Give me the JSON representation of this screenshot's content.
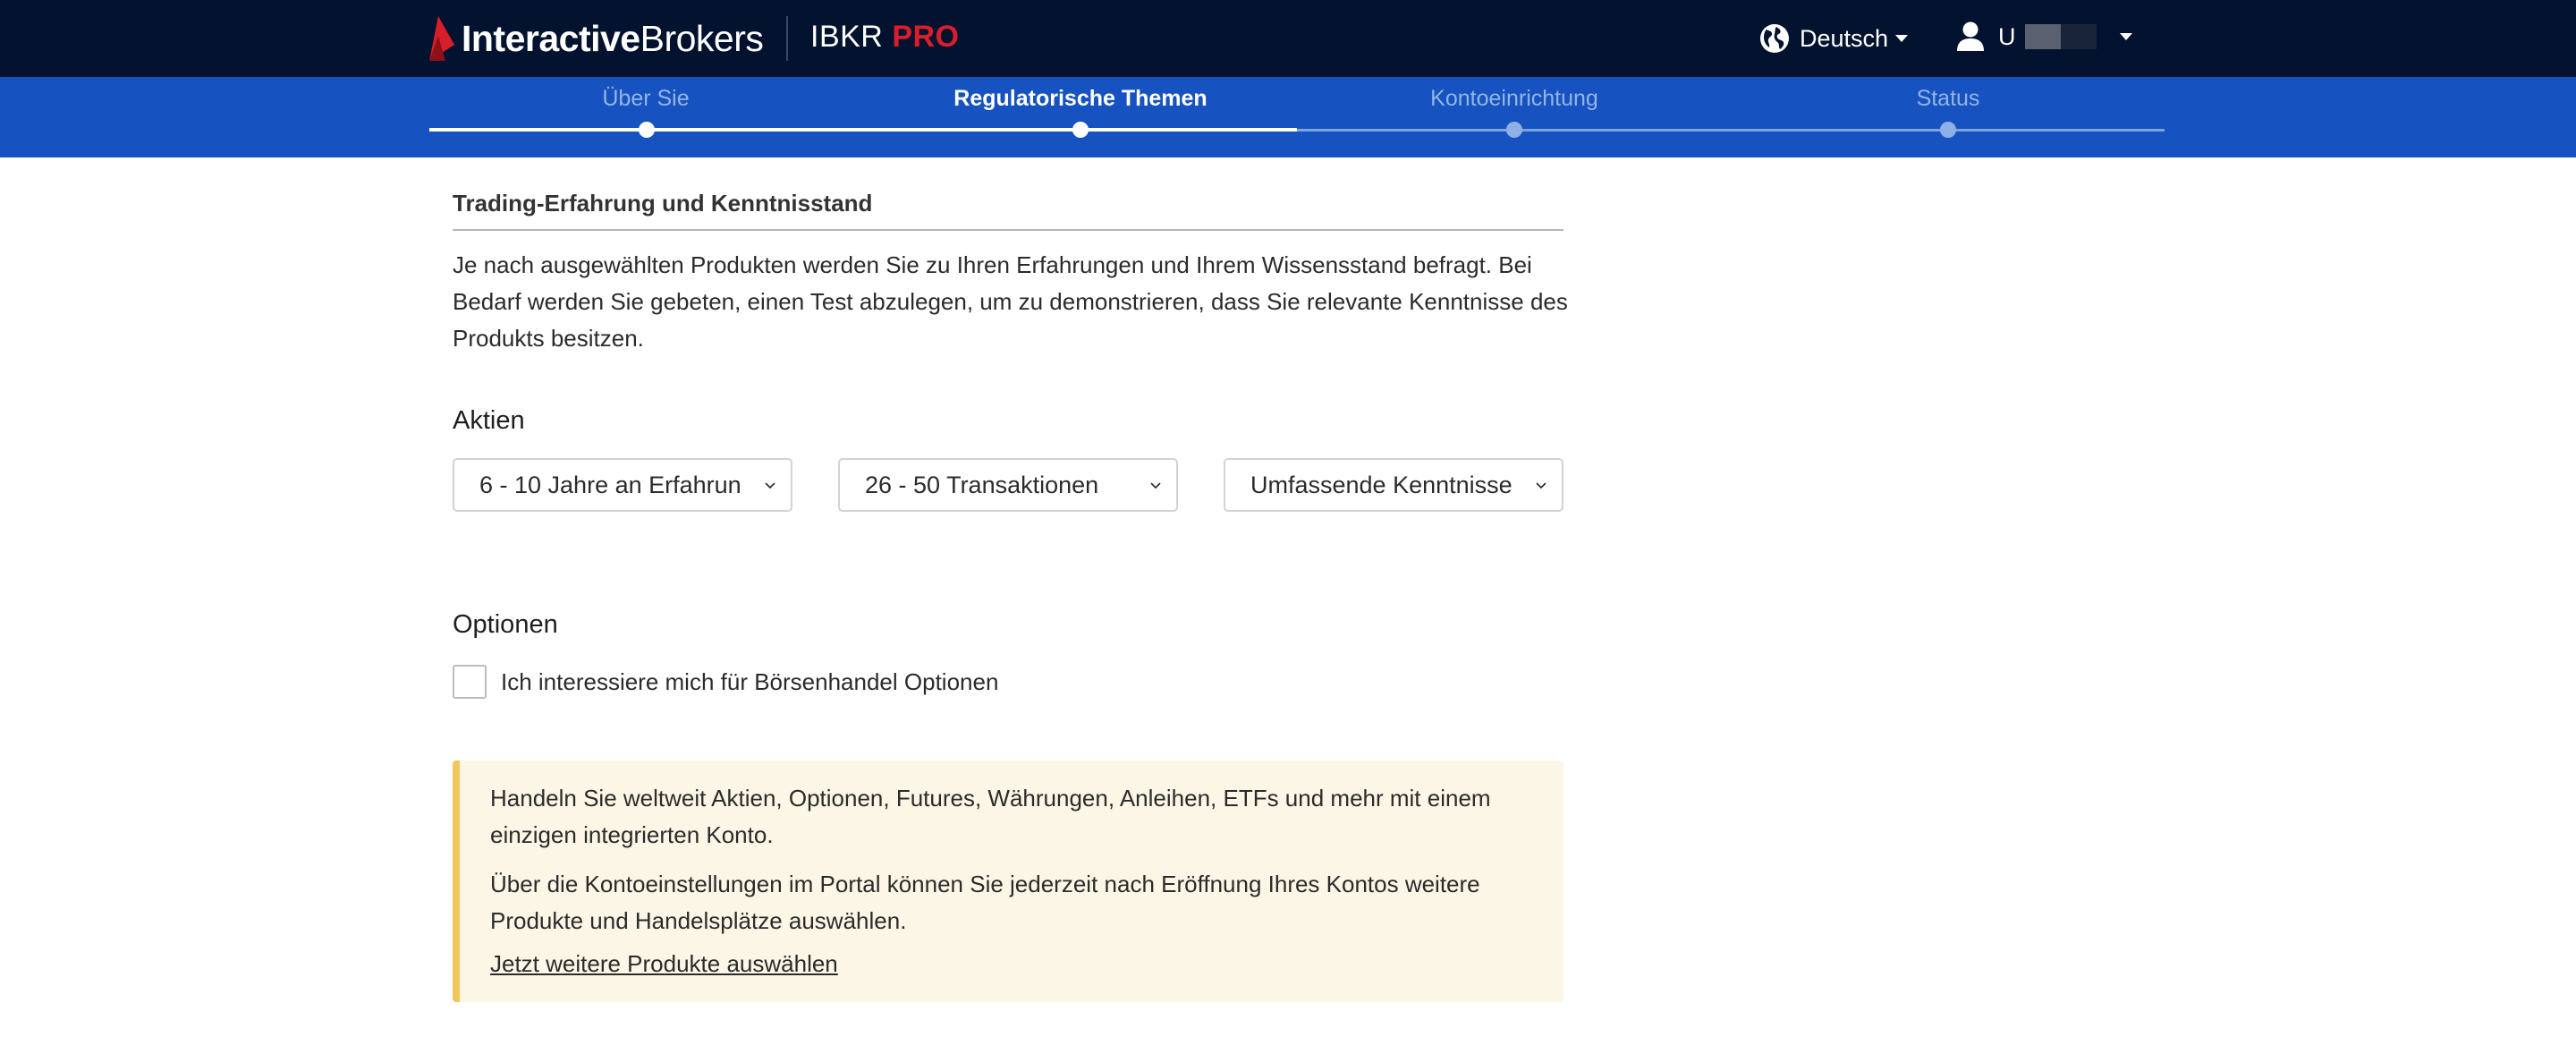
{
  "header": {
    "brand_prefix": "Interactive",
    "brand_suffix": "Brokers",
    "product_name": "IBKR",
    "product_tier": "PRO",
    "language_label": "Deutsch",
    "user_label": "U",
    "icons": {
      "globe": "globe-icon",
      "user": "user-icon",
      "caret": "caret-down-icon"
    },
    "colors": {
      "background": "#03122e",
      "accent": "#d91e2b"
    }
  },
  "stepper": {
    "steps": [
      {
        "label": "Über Sie",
        "state": "done"
      },
      {
        "label": "Regulatorische Themen",
        "state": "active"
      },
      {
        "label": "Kontoeinrichtung",
        "state": "todo"
      },
      {
        "label": "Status",
        "state": "todo"
      }
    ],
    "colors": {
      "background": "#1753c0"
    }
  },
  "experience": {
    "title": "Trading-Erfahrung und Kenntnisstand",
    "intro": "Je nach ausgewählten Produkten werden Sie zu Ihren Erfahrungen und Ihrem Wissensstand befragt. Bei Bedarf werden Sie gebeten, einen Test abzulegen, um zu demonstrieren, dass Sie relevante Kenntnisse des Produkts besitzen."
  },
  "stocks": {
    "label": "Aktien",
    "years_selected": "6 - 10 Jahre an Erfahrung",
    "transactions_selected": "26 - 50 Transaktionen",
    "knowledge_selected": "Umfassende Kenntnisse"
  },
  "options": {
    "label": "Optionen",
    "checkbox_label": "Ich interessiere mich für Börsenhandel Optionen",
    "checked": false
  },
  "notice": {
    "paragraph1": "Handeln Sie weltweit Aktien, Optionen, Futures, Währungen, Anleihen, ETFs und mehr mit einem einzigen integrierten Konto.",
    "paragraph2": "Über die Kontoeinstellungen im Portal können Sie jederzeit nach Eröffnung Ihres Kontos weitere Produkte und Handelsplätze auswählen.",
    "link_text": "Jetzt weitere Produkte auswählen",
    "colors": {
      "background": "#fcf6e6",
      "border": "#f1c75b"
    }
  }
}
